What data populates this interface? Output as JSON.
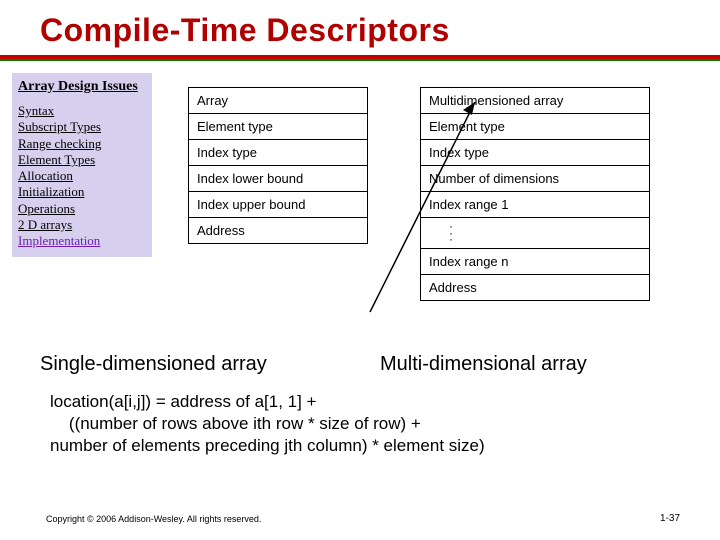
{
  "title": "Compile-Time Descriptors",
  "sidebar": {
    "heading": "Array Design Issues",
    "items": [
      "Syntax",
      "Subscript Types",
      "Range checking",
      "Element Types",
      "Allocation",
      "Initialization",
      "Operations",
      "2 D arrays",
      "Implementation"
    ]
  },
  "single": {
    "caption": "Single-dimensioned array",
    "rows": [
      "Array",
      "Element type",
      "Index type",
      "Index lower bound",
      "Index upper bound",
      "Address"
    ]
  },
  "multi": {
    "caption": "Multi-dimensional array",
    "rows_head": [
      "Multidimensioned array",
      "Element type",
      "Index type",
      "Number of dimensions",
      "Index range 1"
    ],
    "rows_tail": [
      "Index range n",
      "Address"
    ]
  },
  "formula": {
    "line1": "location(a[i,j]) = address of a[1, 1] +",
    "line2": "((number of rows above ith row * size of row) +",
    "line3": "number of elements preceding jth column) * element size)"
  },
  "footer": {
    "copyright": "Copyright © 2006 Addison-Wesley. All rights reserved.",
    "pagenum": "1-37"
  }
}
